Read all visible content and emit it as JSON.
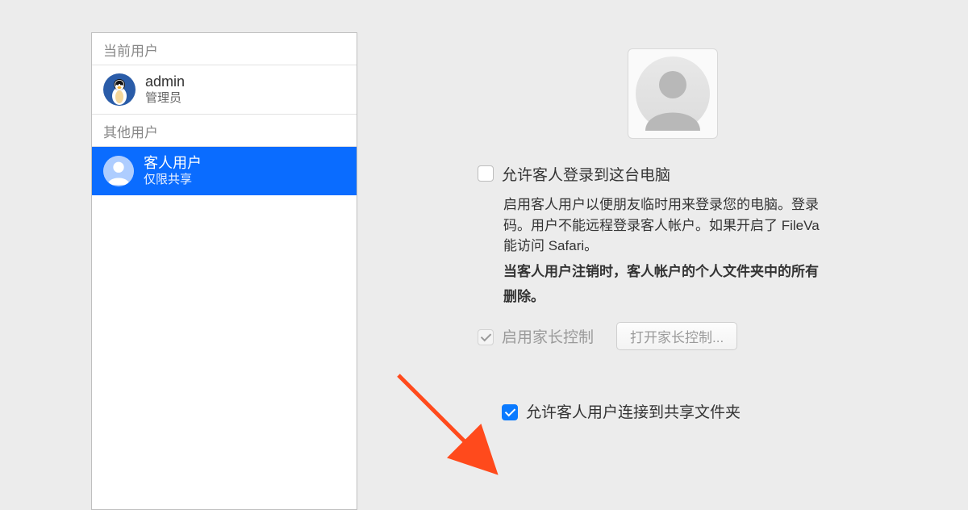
{
  "sidebar": {
    "currentUserHeader": "当前用户",
    "otherUsersHeader": "其他用户",
    "admin": {
      "name": "admin",
      "role": "管理员"
    },
    "guest": {
      "name": "客人用户",
      "role": "仅限共享"
    }
  },
  "main": {
    "allowGuestLogin": {
      "label": "允许客人登录到这台电脑",
      "checked": false
    },
    "desc1": "启用客人用户以便朋友临时用来登录您的电脑。登录",
    "desc2": "码。用户不能远程登录客人帐户。如果开启了 FileVa",
    "desc3": "能访问 Safari。",
    "descBold1": "当客人用户注销时，客人帐户的个人文件夹中的所有",
    "descBold2": "删除。",
    "parental": {
      "label": "启用家长控制",
      "checked": true,
      "button": "打开家长控制..."
    },
    "allowShared": {
      "label": "允许客人用户连接到共享文件夹",
      "checked": true
    }
  }
}
